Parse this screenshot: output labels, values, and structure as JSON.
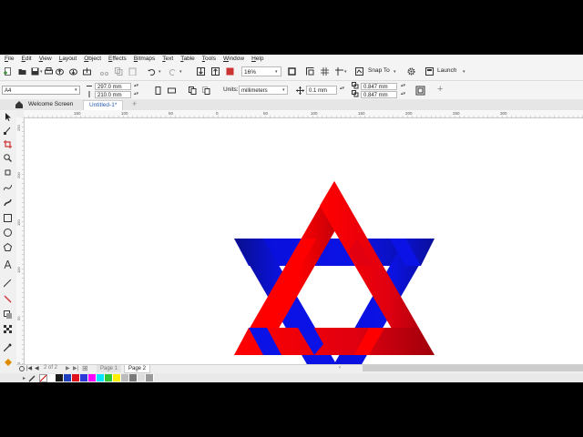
{
  "menu": [
    "File",
    "Edit",
    "View",
    "Layout",
    "Object",
    "Effects",
    "Bitmaps",
    "Text",
    "Table",
    "Tools",
    "Window",
    "Help"
  ],
  "toolbar": {
    "zoom": "16%",
    "snap_to": "Snap To",
    "launch": "Launch"
  },
  "property_bar": {
    "page_size": "A4",
    "width": "297.0 mm",
    "height": "210.0 mm",
    "units_label": "Units:",
    "units_value": "millimeters",
    "nudge": "0.1 mm",
    "dup_x": "0.847 mm",
    "dup_y": "0.847 mm"
  },
  "tabs": [
    "Welcome Screen",
    "Untitled-1*"
  ],
  "ruler_h": [
    "150",
    "100",
    "50",
    "0",
    "50",
    "100",
    "150",
    "200",
    "250",
    "300"
  ],
  "ruler_v": [
    "250",
    "200",
    "150",
    "100",
    "50",
    "0"
  ],
  "page_tabs": [
    "Page 1",
    "Page 2"
  ],
  "page_counter": "2 of 2",
  "colors": {
    "blue": "#0b12e6",
    "red": "#ff0000",
    "dark_red": "#b0000b",
    "dark_blue": "#0a0f8c"
  },
  "palette": [
    "#ffffff",
    "#1a1a1a",
    "#1f3fbf",
    "#e0141e",
    "#2b3ad6",
    "#ff00ff",
    "#00e5ff",
    "#33c633",
    "#ffee00",
    "#bbbbbb",
    "#7a7a7a",
    "#dddddd",
    "#9a9a9a"
  ]
}
